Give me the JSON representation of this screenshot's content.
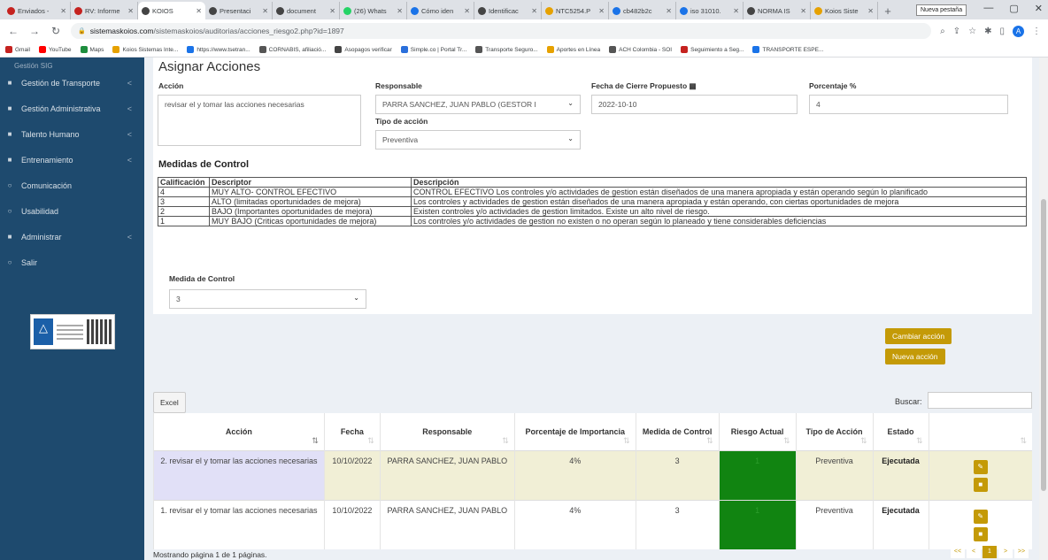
{
  "browser": {
    "tabs": [
      {
        "title": "Enviados -",
        "color": "#c5221f"
      },
      {
        "title": "RV: Informe",
        "color": "#c5221f"
      },
      {
        "title": "KOIOS",
        "color": "#444444",
        "active": true
      },
      {
        "title": "Presentaci",
        "color": "#444444"
      },
      {
        "title": "document",
        "color": "#444444"
      },
      {
        "title": "(26) Whats",
        "color": "#25d366"
      },
      {
        "title": "Cómo iden",
        "color": "#1a73e8"
      },
      {
        "title": "Identificac",
        "color": "#444444"
      },
      {
        "title": "NTC5254.P",
        "color": "#e6a100"
      },
      {
        "title": "cb482b2c",
        "color": "#1a73e8"
      },
      {
        "title": "iso 31010.",
        "color": "#1a73e8"
      },
      {
        "title": "NORMA IS",
        "color": "#444444"
      },
      {
        "title": "Koios Siste",
        "color": "#e6a100"
      }
    ],
    "tooltip": "Nueva pestaña",
    "url_host": "sistemaskoios.com",
    "url_path": "/sistemaskoios/auditorias/acciones_riesgo2.php?id=1897",
    "bookmarks": [
      "Gmail",
      "YouTube",
      "Maps",
      "Koios Sistemas Inte...",
      "https://www.tsetran...",
      "CORNABIS, afiliació...",
      "Asopagos verificar",
      "Simple.co | Portal Tr...",
      "Transporte Seguro...",
      "Aportes en Línea",
      "ACH Colombia - SOI",
      "Seguimiento a Seg...",
      "TRANSPORTE ESPE..."
    ]
  },
  "sidebar": {
    "partial_item": "Gestión SIG",
    "items": [
      {
        "label": "Gestión de Transporte",
        "chev": "<"
      },
      {
        "label": "Gestión Administrativa",
        "chev": "<"
      },
      {
        "label": "Talento Humano",
        "chev": "<"
      },
      {
        "label": "Entrenamiento",
        "chev": "<"
      },
      {
        "label": "Comunicación",
        "chev": ""
      },
      {
        "label": "Usabilidad",
        "chev": ""
      },
      {
        "label": "Administrar",
        "chev": "<"
      },
      {
        "label": "Salir",
        "chev": ""
      }
    ]
  },
  "form": {
    "title": "Asignar Acciones",
    "accion_label": "Acción",
    "accion_value": "revisar el y tomar las acciones necesarias",
    "responsable_label": "Responsable",
    "responsable_value": "PARRA SANCHEZ, JUAN PABLO (GESTOR I",
    "fecha_label": "Fecha de Cierre Propuesto",
    "fecha_value": "2022-10-10",
    "porcentaje_label": "Porcentaje %",
    "porcentaje_value": "4",
    "tipo_label": "Tipo de acción",
    "tipo_value": "Preventiva",
    "medidas_title": "Medidas de Control",
    "medidas_headers": [
      "Calificación",
      "Descriptor",
      "Descripción"
    ],
    "medidas_rows": [
      [
        "4",
        "MUY ALTO- CONTROL EFECTIVO",
        "CONTROL EFECTIVO Los controles y/o actividades de gestion están diseñados de una manera apropiada y están operando según lo planificado"
      ],
      [
        "3",
        "ALTO (limitadas oportunidades de mejora)",
        "Los controles y actividades de gestion están diseñados de una manera apropiada y están operando, con ciertas oportunidades de mejora"
      ],
      [
        "2",
        "BAJO (Importantes oportunidades de mejora)",
        "Existen controles y/o actividades de gestion limitados. Existe un alto nivel de riesgo."
      ],
      [
        "1",
        "MUY BAJO (Criticas oportunidades de mejora)",
        "Los controles y/o actividades de gestion no existen o no operan según lo planeado y tiene considerables deficiencias"
      ]
    ],
    "medida_label": "Medida de Control",
    "medida_value": "3",
    "cambiar_label": "Cambiar acción",
    "nueva_label": "Nueva acción"
  },
  "table": {
    "excel_label": "Excel",
    "buscar_label": "Buscar:",
    "headers": [
      "Acción",
      "Fecha",
      "Responsable",
      "Porcentaje de Importancia",
      "Medida de Control",
      "Riesgo Actual",
      "Tipo de Acción",
      "Estado",
      ""
    ],
    "rows": [
      {
        "accion": "2. revisar el y tomar las acciones necesarias",
        "fecha": "10/10/2022",
        "responsable": "PARRA SANCHEZ, JUAN PABLO",
        "porcentaje": "4%",
        "medida": "3",
        "riesgo": "1",
        "tipo": "Preventiva",
        "estado": "Ejecutada"
      },
      {
        "accion": "1. revisar el y tomar las acciones necesarias",
        "fecha": "10/10/2022",
        "responsable": "PARRA SANCHEZ, JUAN PABLO",
        "porcentaje": "4%",
        "medida": "3",
        "riesgo": "1",
        "tipo": "Preventiva",
        "estado": "Ejecutada"
      }
    ],
    "footer_info": "Mostrando página 1 de 1 páginas.",
    "pager": [
      "<<",
      "<",
      "1",
      ">",
      ">>"
    ],
    "pager_current": "1"
  },
  "colors": {
    "sidebar_bg": "#1e4a6e",
    "accent_gold": "#c49a07",
    "risk_green": "#118411"
  }
}
